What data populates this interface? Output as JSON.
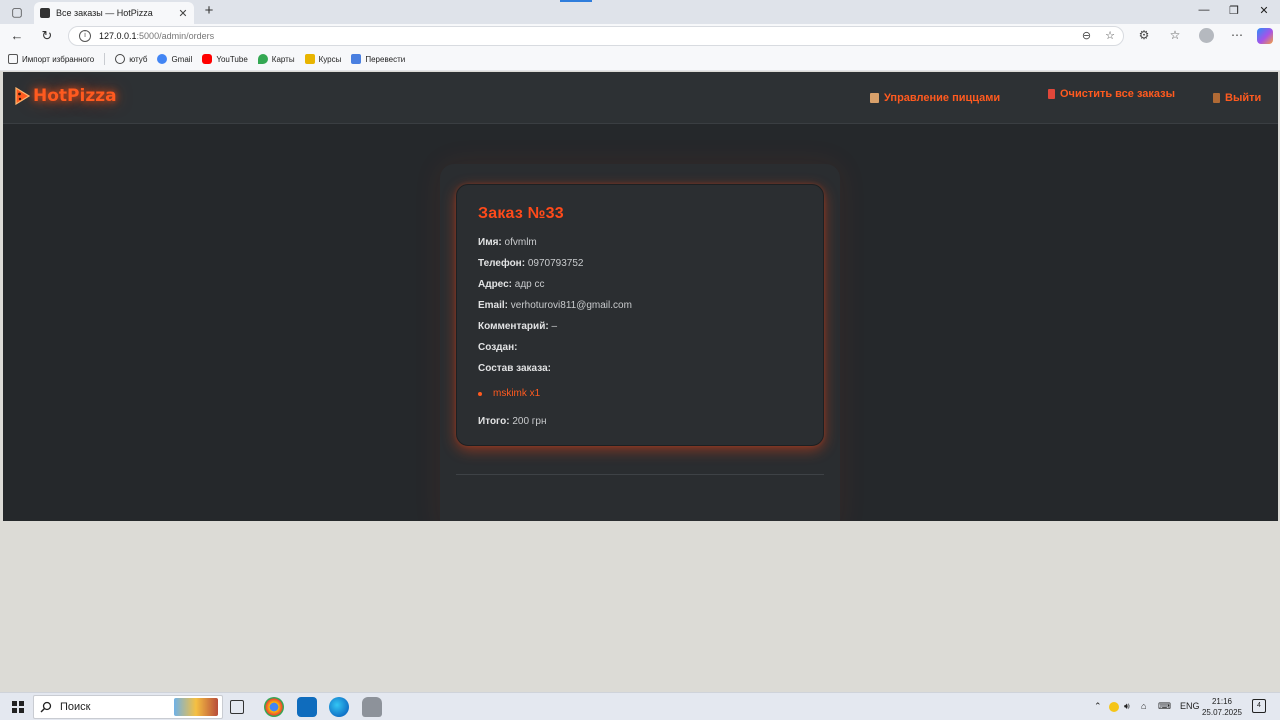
{
  "browser": {
    "tab_title": "Все заказы — HotPizza",
    "tab_close": "✕",
    "new_tab": "+",
    "url_host": "127.0.0.1",
    "url_path": ":5000/admin/orders",
    "bookmarks": [
      {
        "label": "Импорт избранного",
        "color": "#555555"
      },
      {
        "label": "ютуб",
        "color": "#444444"
      },
      {
        "label": "Gmail",
        "color": "#4285f4"
      },
      {
        "label": "YouTube",
        "color": "#ff0000"
      },
      {
        "label": "Карты",
        "color": "#34a853"
      },
      {
        "label": "Курсы",
        "color": "#e8b400"
      },
      {
        "label": "Перевести",
        "color": "#4a7fe0"
      }
    ]
  },
  "site": {
    "logo": "HotPizza",
    "nav": {
      "manage_pizzas": "Управление пиццами",
      "clear_orders": "Очистить все заказы",
      "logout": "Выйти"
    },
    "accent": "#ff5a1f"
  },
  "order": {
    "title": "Заказ №33",
    "fields": [
      {
        "label": "Имя:",
        "value": " ofvmlm"
      },
      {
        "label": "Телефон:",
        "value": " 0970793752"
      },
      {
        "label": "Адрес:",
        "value": " адр сс"
      },
      {
        "label": "Email:",
        "value": " verhoturovi811@gmail.com"
      },
      {
        "label": "Комментарий:",
        "value": " –"
      },
      {
        "label": "Создан:",
        "value": ""
      },
      {
        "label": "Состав заказа:",
        "value": ""
      }
    ],
    "items": [
      "mskimk x1"
    ],
    "total_label": "Итого:",
    "total_value": " 200 грн"
  },
  "taskbar": {
    "search_placeholder": "Поиск",
    "lang": "ENG",
    "time": "21:16",
    "date": "25.07.2025",
    "notifications": "4"
  }
}
